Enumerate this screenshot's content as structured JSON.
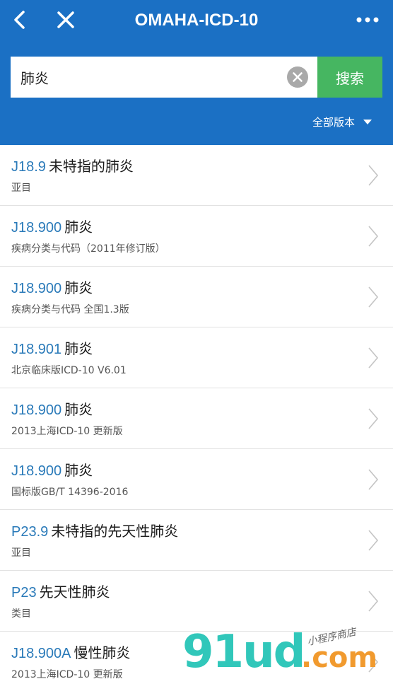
{
  "header": {
    "title": "OMAHA-ICD-10"
  },
  "search": {
    "value": "肺炎",
    "button_label": "搜索"
  },
  "version_filter": {
    "label": "全部版本"
  },
  "results": [
    {
      "code": "J18.9",
      "name": "未特指的肺炎",
      "sub": "亚目"
    },
    {
      "code": "J18.900",
      "name": "肺炎",
      "sub": "疾病分类与代码（2011年修订版）"
    },
    {
      "code": "J18.900",
      "name": "肺炎",
      "sub": "疾病分类与代码 全国1.3版"
    },
    {
      "code": "J18.901",
      "name": "肺炎",
      "sub": "北京临床版ICD-10 V6.01"
    },
    {
      "code": "J18.900",
      "name": "肺炎",
      "sub": "2013上海ICD-10 更新版"
    },
    {
      "code": "J18.900",
      "name": "肺炎",
      "sub": "国标版GB/T 14396-2016"
    },
    {
      "code": "P23.9",
      "name": "未特指的先天性肺炎",
      "sub": "亚目"
    },
    {
      "code": "P23",
      "name": "先天性肺炎",
      "sub": "类目"
    },
    {
      "code": "J18.900A",
      "name": "慢性肺炎",
      "sub": "2013上海ICD-10 更新版"
    }
  ],
  "watermark": {
    "main": "91ud",
    "dot": ".com",
    "sub": "小程序商店"
  },
  "colors": {
    "header_bg": "#1b70c4",
    "search_button": "#46b661",
    "code_text": "#2a7ab9"
  }
}
